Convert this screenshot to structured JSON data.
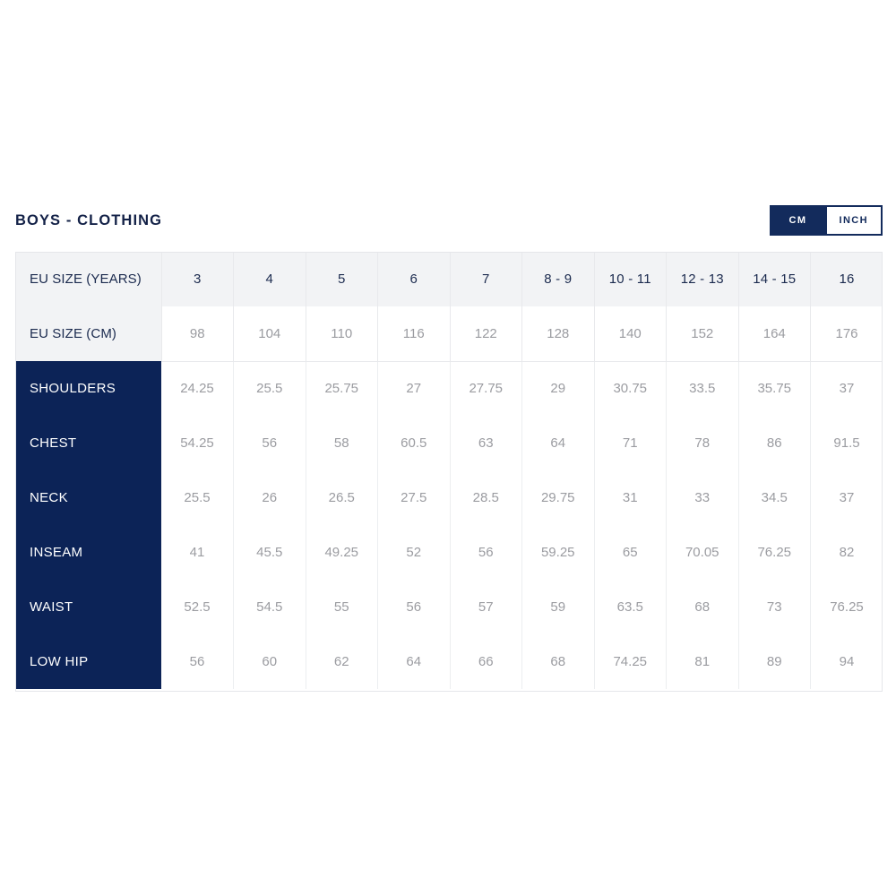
{
  "header": {
    "title": "BOYS - CLOTHING"
  },
  "unit_toggle": {
    "name": "unit-toggle",
    "selected": "CM",
    "options": [
      {
        "label": "CM",
        "active": true
      },
      {
        "label": "INCH",
        "active": false
      }
    ]
  },
  "colors": {
    "navy": "#0c2357",
    "navy_title": "#132147",
    "header_gray": "#f2f3f5",
    "value_gray": "#9b9ca1",
    "border": "#e8e9ec"
  },
  "table": {
    "header_rows": [
      {
        "label": "EU SIZE (YEARS)",
        "values": [
          "3",
          "4",
          "5",
          "6",
          "7",
          "8 - 9",
          "10 - 11",
          "12 - 13",
          "14 - 15",
          "16"
        ]
      },
      {
        "label": "EU SIZE (CM)",
        "values": [
          "98",
          "104",
          "110",
          "116",
          "122",
          "128",
          "140",
          "152",
          "164",
          "176"
        ]
      }
    ],
    "data_rows": [
      {
        "label": "SHOULDERS",
        "values": [
          "24.25",
          "25.5",
          "25.75",
          "27",
          "27.75",
          "29",
          "30.75",
          "33.5",
          "35.75",
          "37"
        ]
      },
      {
        "label": "CHEST",
        "values": [
          "54.25",
          "56",
          "58",
          "60.5",
          "63",
          "64",
          "71",
          "78",
          "86",
          "91.5"
        ]
      },
      {
        "label": "NECK",
        "values": [
          "25.5",
          "26",
          "26.5",
          "27.5",
          "28.5",
          "29.75",
          "31",
          "33",
          "34.5",
          "37"
        ]
      },
      {
        "label": "INSEAM",
        "values": [
          "41",
          "45.5",
          "49.25",
          "52",
          "56",
          "59.25",
          "65",
          "70.05",
          "76.25",
          "82"
        ]
      },
      {
        "label": "WAIST",
        "values": [
          "52.5",
          "54.5",
          "55",
          "56",
          "57",
          "59",
          "63.5",
          "68",
          "73",
          "76.25"
        ]
      },
      {
        "label": "LOW HIP",
        "values": [
          "56",
          "60",
          "62",
          "64",
          "66",
          "68",
          "74.25",
          "81",
          "89",
          "94"
        ]
      }
    ]
  }
}
